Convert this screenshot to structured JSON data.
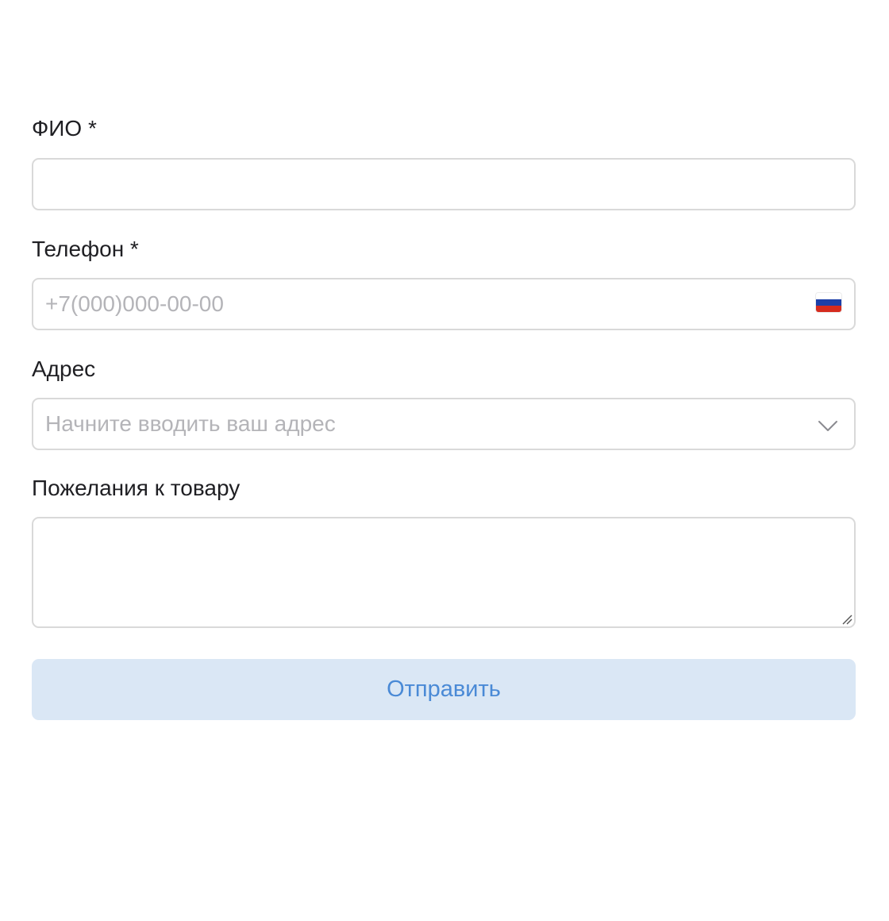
{
  "form": {
    "fio": {
      "label": "ФИО *",
      "value": "",
      "placeholder": ""
    },
    "phone": {
      "label": "Телефон *",
      "value": "",
      "placeholder": "+7(000)000-00-00",
      "flag_icon": "russia-flag-icon",
      "flag_colors": [
        "#ffffff",
        "#1c3fa8",
        "#d52b1e"
      ]
    },
    "address": {
      "label": "Адрес",
      "value": "",
      "placeholder": "Начните вводить ваш адрес",
      "dropdown_icon": "chevron-down-icon"
    },
    "wishes": {
      "label": "Пожелания к товару",
      "value": ""
    },
    "submit": {
      "label": "Отправить",
      "background": "#dae7f5",
      "text_color": "#4a8ad6"
    }
  }
}
